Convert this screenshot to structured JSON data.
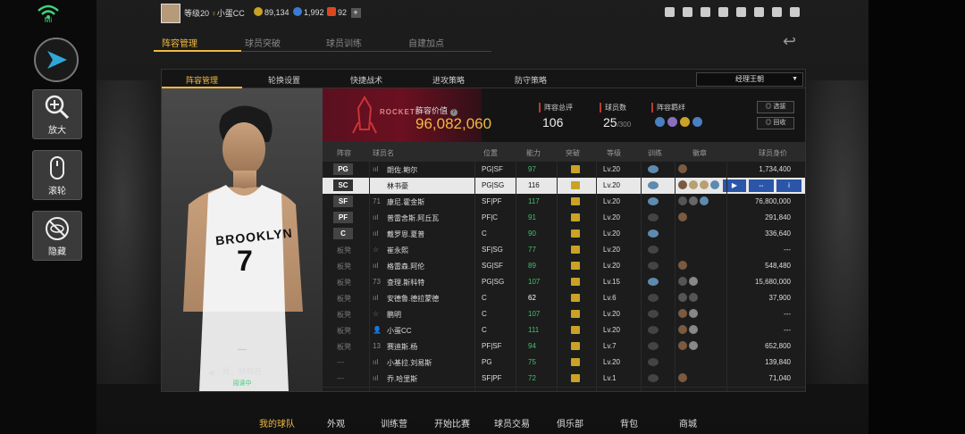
{
  "status": {
    "wifi_label": "Mi"
  },
  "rail": {
    "zoom_label": "放大",
    "scroll_label": "滚轮",
    "hide_label": "隐藏"
  },
  "topbar": {
    "level": "等级20",
    "username": "小蛋CC",
    "gold": "89,134",
    "gems": "1,992",
    "points": "92",
    "plus": "+"
  },
  "tabs": [
    "阵容管理",
    "球员突破",
    "球员训练",
    "自建加点"
  ],
  "subtabs": [
    "阵容管理",
    "轮换设置",
    "快捷战术",
    "进攻策略",
    "防守策略"
  ],
  "dropdown": {
    "value": "经理王朝",
    "caret": "▼"
  },
  "card": {
    "name": "我，林疯狂",
    "status": "阅读中",
    "arrow": "◀",
    "number": "7",
    "jersey": "BROOKLYN",
    "dash": "—"
  },
  "team": {
    "name": "ROCKETS",
    "value_label": "阵容价值",
    "value": "96,082,060",
    "rating_label": "阵容总评",
    "rating": "106",
    "count_label": "球员数",
    "count": "25",
    "count_max": "/300",
    "bond_label": "阵容羁绊",
    "btn_select": "◎ 选拔",
    "btn_recycle": "◎ 回收"
  },
  "table": {
    "headers": [
      "阵容",
      "球员名",
      "位置",
      "能力",
      "突破",
      "等级",
      "训练",
      "徽章",
      "球员身价"
    ],
    "rows": [
      {
        "slot": "PG",
        "num": "ııl",
        "name": "朗佐.鲍尔",
        "pos": "PG|SF",
        "ovr": "97",
        "lv": "Lv.20",
        "price": "1,734,400",
        "train": "#5f8ab0",
        "badges": [
          "#7a5a40"
        ],
        "color": "c-green"
      },
      {
        "slot": "SC",
        "num": "",
        "name": "林书豪",
        "pos": "PG|SG",
        "ovr": "116",
        "lv": "Lv.20",
        "price": "",
        "train": "#5f8ab0",
        "badges": [
          "#7a5a40",
          "#b8a070",
          "#b8a070",
          "#5f8ab0"
        ],
        "color": "c-white",
        "selected": true
      },
      {
        "slot": "SF",
        "num": "71",
        "name": "康尼.霍金斯",
        "pos": "SF|PF",
        "ovr": "117",
        "lv": "Lv.20",
        "price": "76,800,000",
        "train": "#5f8ab0",
        "badges": [
          "#555",
          "#666",
          "#5f8ab0"
        ],
        "color": "c-green"
      },
      {
        "slot": "PF",
        "num": "ııl",
        "name": "普雷舍斯.阿丘瓦",
        "pos": "PF|C",
        "ovr": "91",
        "lv": "Lv.20",
        "price": "291,840",
        "train": "#444",
        "badges": [
          "#7a5a40"
        ],
        "color": "c-green"
      },
      {
        "slot": "C",
        "num": "ııl",
        "name": "戴罗恩.夏普",
        "pos": "C",
        "ovr": "90",
        "lv": "Lv.20",
        "price": "336,640",
        "train": "#5f8ab0",
        "badges": [],
        "color": "c-green"
      },
      {
        "slot": "板凳",
        "num": "☆",
        "name": "崔永熙",
        "pos": "SF|SG",
        "ovr": "77",
        "lv": "Lv.20",
        "price": "---",
        "train": "#444",
        "badges": [],
        "color": "c-green"
      },
      {
        "slot": "板凳",
        "num": "ııl",
        "name": "格雷森.阿伦",
        "pos": "SG|SF",
        "ovr": "89",
        "lv": "Lv.20",
        "price": "548,480",
        "train": "#444",
        "badges": [
          "#7a5a40"
        ],
        "color": "c-green"
      },
      {
        "slot": "板凳",
        "num": "73",
        "name": "查理.斯科特",
        "pos": "PG|SG",
        "ovr": "107",
        "lv": "Lv.15",
        "price": "15,680,000",
        "train": "#5f8ab0",
        "badges": [
          "#555",
          "#888"
        ],
        "color": "c-green"
      },
      {
        "slot": "板凳",
        "num": "ııl",
        "name": "安德鲁.德拉蒙德",
        "pos": "C",
        "ovr": "62",
        "lv": "Lv.6",
        "price": "37,900",
        "train": "#444",
        "badges": [
          "#555",
          "#555"
        ],
        "color": "c-white"
      },
      {
        "slot": "板凳",
        "num": "☆",
        "name": "鹏明",
        "pos": "C",
        "ovr": "107",
        "lv": "Lv.20",
        "price": "---",
        "train": "#444",
        "badges": [
          "#7a5a40",
          "#888"
        ],
        "color": "c-green"
      },
      {
        "slot": "板凳",
        "num": "👤",
        "name": "小蛋CC",
        "pos": "C",
        "ovr": "111",
        "lv": "Lv.20",
        "price": "---",
        "train": "#444",
        "badges": [
          "#7a5a40",
          "#888"
        ],
        "color": "c-green"
      },
      {
        "slot": "板凳",
        "num": "13",
        "name": "赛迪斯.杨",
        "pos": "PF|SF",
        "ovr": "94",
        "lv": "Lv.7",
        "price": "652,800",
        "train": "#444",
        "badges": [
          "#7a5a40",
          "#888"
        ],
        "color": "c-green"
      },
      {
        "slot": "---",
        "num": "ııl",
        "name": "小基拉.刘易斯",
        "pos": "PG",
        "ovr": "75",
        "lv": "Lv.20",
        "price": "139,840",
        "train": "#444",
        "badges": [],
        "color": "c-green"
      },
      {
        "slot": "---",
        "num": "ııl",
        "name": "乔.哈里斯",
        "pos": "SF|PF",
        "ovr": "72",
        "lv": "Lv.1",
        "price": "71,040",
        "train": "#444",
        "badges": [
          "#7a5a40"
        ],
        "color": "c-green"
      }
    ],
    "actions": {
      "a": "▶",
      "b": "⇔",
      "c": "i"
    }
  },
  "bottom_nav": [
    "我的球队",
    "外观",
    "训练营",
    "开始比赛",
    "球员交易",
    "俱乐部",
    "背包",
    "商城"
  ],
  "colors": {
    "accent": "#f2b940",
    "green": "#3ec26b",
    "red": "#c0392b"
  }
}
